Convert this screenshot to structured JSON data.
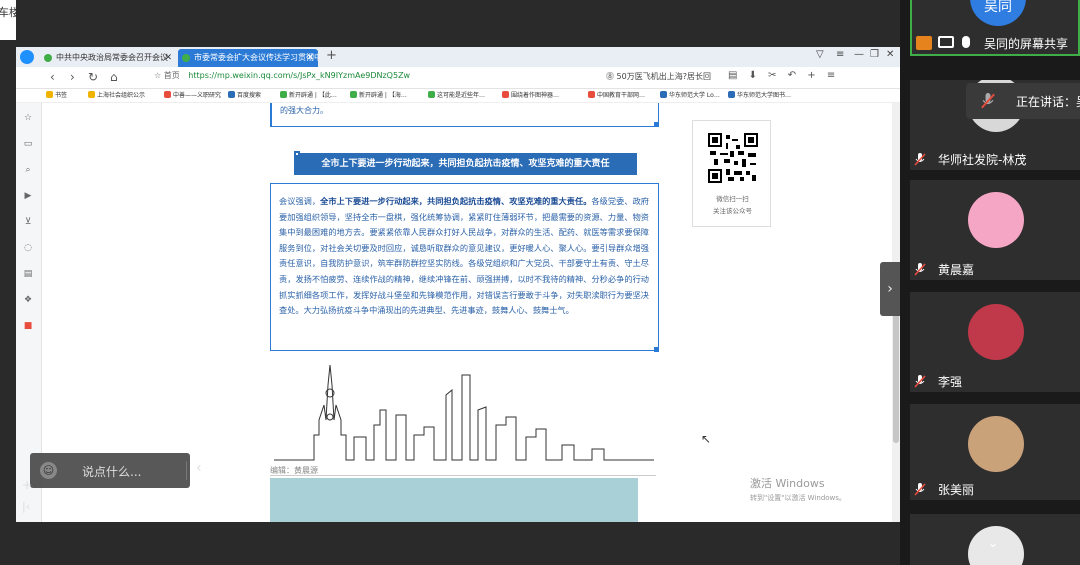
{
  "left_strip_text": "车楼",
  "browser": {
    "tabs": [
      {
        "label": "中共中央政治局常委会召开会议"
      },
      {
        "label": "市委常委会扩大会议传达学习贯彻中"
      }
    ],
    "nav": {
      "back": "‹",
      "forward": "›",
      "reload": "↻",
      "home": "⌂",
      "bookmark_label": "☆ 首页",
      "url": "https://mp.weixin.qq.com/s/JsPx_kN9IYzmAe9DNzQ5Zw",
      "search_hint": "50万医飞机出上海?居长回",
      "icons": "▤ ⬇ ✂ ↶ + ≡"
    },
    "bookmarks": [
      {
        "label": "书签",
        "color": "#f0b400"
      },
      {
        "label": "上海社会组织公示",
        "color": "#f0b400"
      },
      {
        "label": "中善——义职研究",
        "color": "#e84c3d"
      },
      {
        "label": "百度搜索",
        "color": "#2b6cb6"
      },
      {
        "label": "新开辟通 | 【此…",
        "color": "#3fae49"
      },
      {
        "label": "新开辟通 | 【海…",
        "color": "#3fae49"
      },
      {
        "label": "这可能是近些年…",
        "color": "#3fae49"
      },
      {
        "label": "围绕着作图神器…",
        "color": "#e84c3d"
      },
      {
        "label": "中国教育干部网…",
        "color": "#e84c3d"
      },
      {
        "label": "华东师范大学 Lo…",
        "color": "#2b6cb6"
      },
      {
        "label": "华东师范大学图书…",
        "color": "#2b6cb6"
      }
    ]
  },
  "article": {
    "prev_text": "的强大合力。",
    "heading": "全市上下要进一步行动起来，共同担负起抗击疫情、攻坚克难的重大责任",
    "body_intro": "会议强调，",
    "body_bold": "全市上下要进一步行动起来，共同担负起抗击疫情、攻坚克难的重大责任。",
    "body_rest": "各级党委、政府要加强组织领导，坚持全市一盘棋，强化统筹协调，紧紧盯住薄弱环节，把最需要的资源、力量、物资集中到最困难的地方去。要紧紧依靠人民群众打好人民战争，对群众的生活、配药、就医等需求要保障服务到位，对社会关切要及时回应，诚恳听取群众的意见建议，更好暖人心、聚人心。要引导群众增强责任意识，自我防护意识，筑牢群防群控坚实防线。各级党组织和广大党员、干部要守土有责、守土尽责，发扬不怕疲劳、连续作战的精神，继续冲锋在前、顽强拼搏，以时不我待的精神、分秒必争的行动抓实抓细各项工作，发挥好战斗堡垒和先锋模范作用，对错误言行要敢于斗争，对失职渎职行为要坚决查处。大力弘扬抗疫斗争中涌现出的先进典型、先进事迹，鼓舞人心、鼓舞士气。",
    "editor": "编辑：黄晨源",
    "qr_caption_1": "微信扫一扫",
    "qr_caption_2": "关注该公众号"
  },
  "watermark": {
    "line1": "激活 Windows",
    "line2": "转到\"设置\"以激活 Windows。"
  },
  "chat": {
    "placeholder": "说点什么..."
  },
  "speaking": {
    "label": "正在讲话：吴"
  },
  "participants": [
    {
      "name": "吴同的屏幕共享",
      "active": true,
      "avatar_text": "吴同"
    },
    {
      "name": "华师社发院-林茂",
      "active": false
    },
    {
      "name": "黄晨嘉",
      "active": false
    },
    {
      "name": "李强",
      "active": false
    },
    {
      "name": "张美丽",
      "active": false
    }
  ],
  "colors": {
    "accent": "#2b6cb6",
    "active_border": "#3fae49",
    "mute": "#e84c3d"
  }
}
